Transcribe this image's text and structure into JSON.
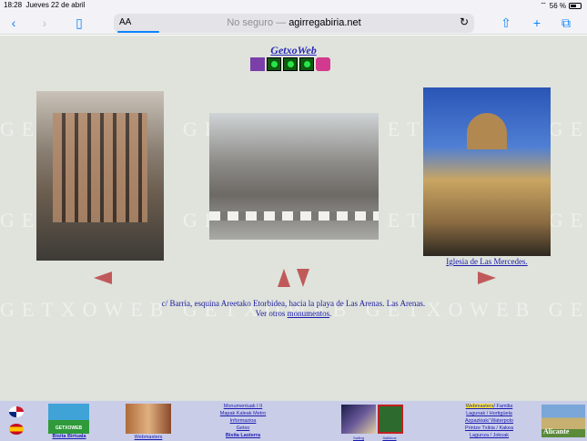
{
  "status_bar": {
    "time": "18:28",
    "date": "Jueves 22 de abril",
    "battery": "56 %"
  },
  "browser": {
    "aa_label": "AA",
    "insecure_label": "No seguro —",
    "domain": "agirregabiria.net"
  },
  "page": {
    "watermark_text": "GETXOWEB GETXOWEB GETXOWEB GETXOWEB",
    "site_title": "GetxoWeb",
    "photo3_caption": "Iglesia de Las Mercedes.",
    "description_line1": "c/ Barria, esquina Areetako Etorbidea, hacia la playa de Las Arenas. Las Arenas.",
    "description_prefix": "Ver otros",
    "description_link": "monumentos",
    "description_suffix": "."
  },
  "footer": {
    "bisita_birtuala": "Bisita Birtuala",
    "webmasters_left": "Webmasters",
    "monumentuak": "Monumentuak I II",
    "mapak": "Mapak Kaleak Metro",
    "informazioa": "Informazioa",
    "getxo": "Getxo",
    "bisita_lasterra": "Bisita Lasterra",
    "game_label": "Sailing",
    "shield_label": "Sailkhos",
    "webmasters_right": "Webmasters",
    "familia": "Familia",
    "lagunak": "Lagunak / Hortigüela",
    "azpazkiak": "Azpazkiak/ Waterpolo",
    "printze_txikia": "Printze Txikia / Kakea",
    "lagunza": "Lagunza / Jokoak",
    "alicante": "Alicante"
  }
}
